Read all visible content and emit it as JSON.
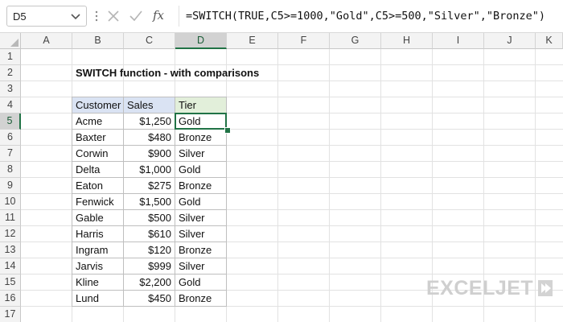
{
  "formula_bar": {
    "name_box": "D5",
    "fx_label": "fx",
    "formula": "=SWITCH(TRUE,C5>=1000,\"Gold\",C5>=500,\"Silver\",\"Bronze\")"
  },
  "columns": [
    "A",
    "B",
    "C",
    "D",
    "E",
    "F",
    "G",
    "H",
    "I",
    "J",
    "K"
  ],
  "active_column": "D",
  "rows": [
    "1",
    "2",
    "3",
    "4",
    "5",
    "6",
    "7",
    "8",
    "9",
    "10",
    "11",
    "12",
    "13",
    "14",
    "15",
    "16",
    "17"
  ],
  "active_row": "5",
  "sheet": {
    "title": "SWITCH function - with comparisons",
    "table": {
      "headers": [
        "Customer",
        "Sales",
        "Tier"
      ],
      "rows": [
        [
          "Acme",
          "$1,250",
          "Gold"
        ],
        [
          "Baxter",
          "$480",
          "Bronze"
        ],
        [
          "Corwin",
          "$900",
          "Silver"
        ],
        [
          "Delta",
          "$1,000",
          "Gold"
        ],
        [
          "Eaton",
          "$275",
          "Bronze"
        ],
        [
          "Fenwick",
          "$1,500",
          "Gold"
        ],
        [
          "Gable",
          "$500",
          "Silver"
        ],
        [
          "Harris",
          "$610",
          "Silver"
        ],
        [
          "Ingram",
          "$120",
          "Bronze"
        ],
        [
          "Jarvis",
          "$999",
          "Silver"
        ],
        [
          "Kline",
          "$2,200",
          "Gold"
        ],
        [
          "Lund",
          "$450",
          "Bronze"
        ]
      ]
    }
  },
  "logo": {
    "text": "EXCELJET",
    "icon": "exceljet-logo-icon"
  },
  "colors": {
    "selection": "#217346",
    "header_blue": "#dae3f3",
    "header_green": "#e2efda"
  }
}
